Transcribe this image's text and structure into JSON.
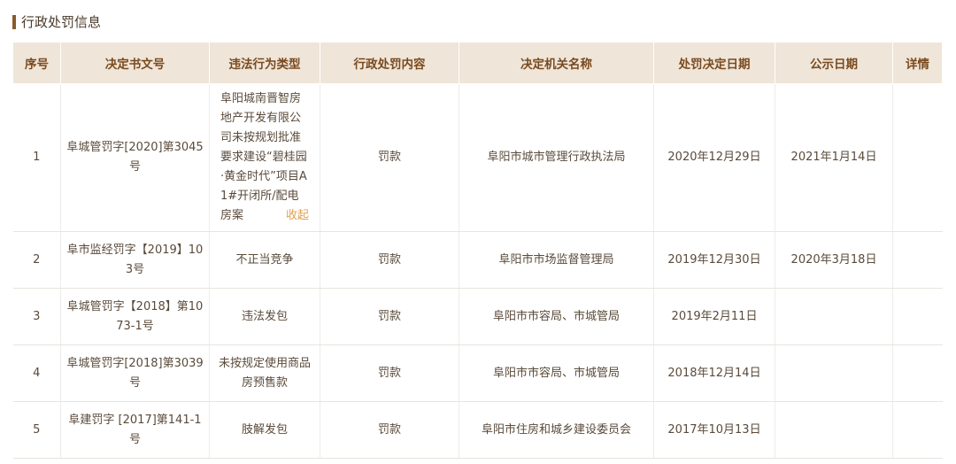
{
  "section": {
    "title": "行政处罚信息"
  },
  "table": {
    "headers": [
      "序号",
      "决定书文号",
      "违法行为类型",
      "行政处罚内容",
      "决定机关名称",
      "处罚决定日期",
      "公示日期",
      "详情"
    ],
    "rows": [
      {
        "no": "1",
        "doc_no": "阜城管罚字[2020]第3045号",
        "violation": "阜阳城南晋智房地产开发有限公司未按规划批准要求建设“碧桂园·黄金时代”项目A1#开闭所/配电房案",
        "collapse_label": "收起",
        "content": "罚款",
        "authority": "阜阳市城市管理行政执法局",
        "decision_date": "2020年12月29日",
        "publish_date": "2021年1月14日",
        "detail": ""
      },
      {
        "no": "2",
        "doc_no": "阜市监经罚字【2019】103号",
        "violation": "不正当竞争",
        "content": "罚款",
        "authority": "阜阳市市场监督管理局",
        "decision_date": "2019年12月30日",
        "publish_date": "2020年3月18日",
        "detail": ""
      },
      {
        "no": "3",
        "doc_no": "阜城管罚字【2018】第1073-1号",
        "violation": "违法发包",
        "content": "罚款",
        "authority": "阜阳市市容局、市城管局",
        "decision_date": "2019年2月11日",
        "publish_date": "",
        "detail": ""
      },
      {
        "no": "4",
        "doc_no": "阜城管罚字[2018]第3039号",
        "violation": "未按规定使用商品房预售款",
        "content": "罚款",
        "authority": "阜阳市市容局、市城管局",
        "decision_date": "2018年12月14日",
        "publish_date": "",
        "detail": ""
      },
      {
        "no": "5",
        "doc_no": "阜建罚字 [2017]第141-1号",
        "violation": "肢解发包",
        "content": "罚款",
        "authority": "阜阳市住房和城乡建设委员会",
        "decision_date": "2017年10月13日",
        "publish_date": "",
        "detail": ""
      }
    ]
  }
}
